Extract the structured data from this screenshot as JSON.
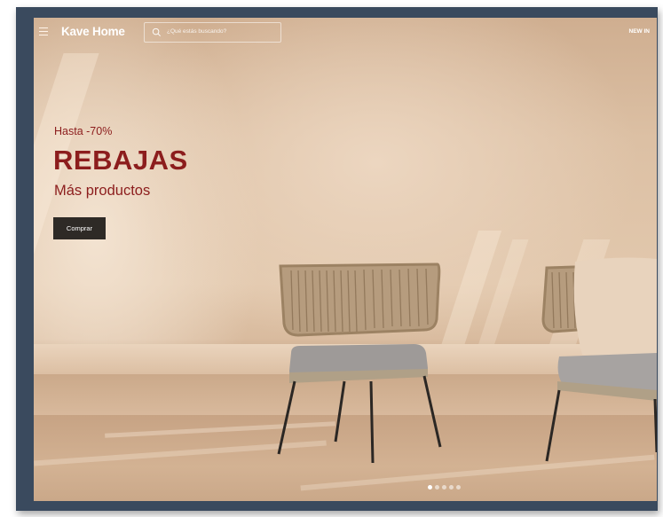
{
  "header": {
    "menu_icon": "hamburger-menu-icon",
    "logo": "Kave Home",
    "search": {
      "placeholder": "¿Qué estás buscando?",
      "icon": "search-icon"
    },
    "nav_right": "NEW IN"
  },
  "hero": {
    "eyebrow": "Hasta -70%",
    "title": "REBAJAS",
    "subtitle": "Más productos",
    "cta_label": "Comprar",
    "text_color": "#8c1d1d",
    "cta_background": "#2e2a26",
    "carousel": {
      "slide_count": 5,
      "active_index": 0
    }
  }
}
